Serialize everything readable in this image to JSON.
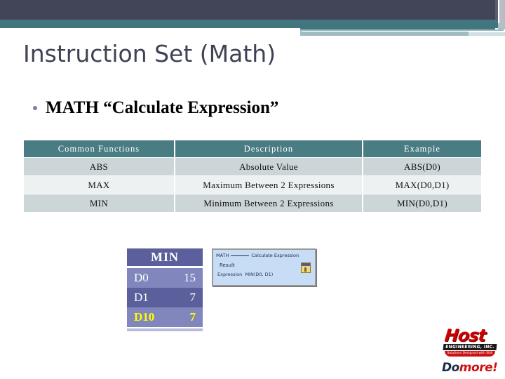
{
  "header": {
    "bar_dark_color": "#424457",
    "bar_teal_color": "#41767e",
    "bar_light_teal_color": "#9fbcc2"
  },
  "slide": {
    "title": "Instruction Set (Math)",
    "bullet": {
      "marker": "bullet-dot",
      "text": "MATH “Calculate Expression”",
      "marker_color": "#8d77a8"
    }
  },
  "functions_table": {
    "headers": [
      "Common Functions",
      "Description",
      "Example"
    ],
    "header_bg": "#4a7c84",
    "rows": [
      {
        "function": "ABS",
        "description": "Absolute Value",
        "example": "ABS(D0)"
      },
      {
        "function": "MAX",
        "description": "Maximum Between 2 Expressions",
        "example": "MAX(D0,D1)"
      },
      {
        "function": "MIN",
        "description": "Minimum Between 2 Expressions",
        "example": "MIN(D0,D1)"
      }
    ]
  },
  "min_table": {
    "title": "MIN",
    "header_bg": "#5b5f9b",
    "highlight_color": "#ffff00",
    "rows": [
      {
        "label": "D0",
        "value": "15"
      },
      {
        "label": "D1",
        "value": "7"
      },
      {
        "label": "D10",
        "value": "7"
      }
    ]
  },
  "instruction_box": {
    "title": "MATH",
    "subtitle": "Calculate Expression",
    "result_label": "Result",
    "expression_label": "Expression",
    "expression_value": "MIN(D0, D1)",
    "icon": "keypad-icon",
    "bg_color": "#c7dcf5"
  },
  "logo": {
    "brand": "Host",
    "company": "ENGINEERING, INC.",
    "tagline": "Solutions Designed with Skill",
    "slogan_1": "Do",
    "slogan_2": "more",
    "slogan_3": "!",
    "brand_color": "#cc0000"
  }
}
